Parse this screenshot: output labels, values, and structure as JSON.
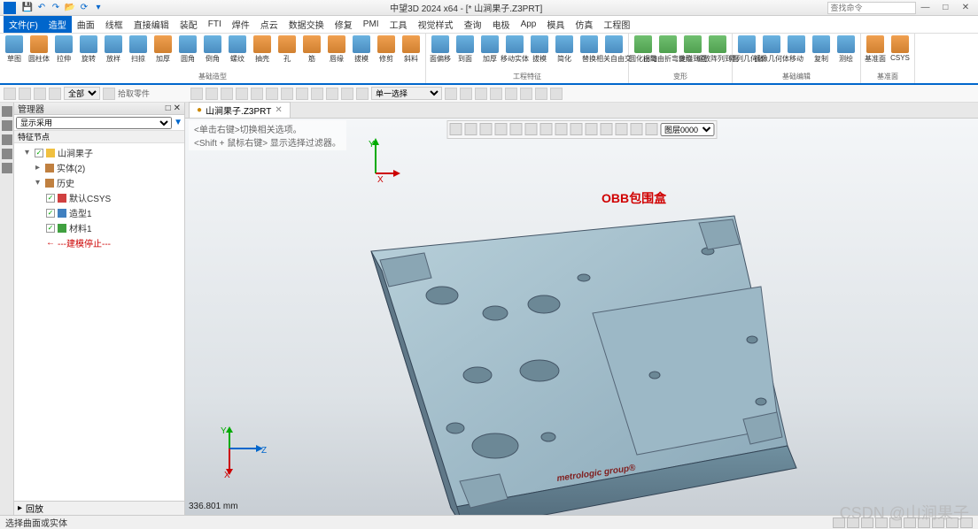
{
  "app": {
    "title": "中望3D 2024 x64 - [* 山涧果子.Z3PRT]",
    "search_placeholder": "查找命令"
  },
  "menu": {
    "file": "文件(F)",
    "items": [
      "造型",
      "曲面",
      "线框",
      "直接编辑",
      "装配",
      "FTI",
      "焊件",
      "点云",
      "数据交换",
      "修复",
      "PMI",
      "工具",
      "视觉样式",
      "查询",
      "电极",
      "App",
      "模具",
      "仿真",
      "工程图"
    ],
    "active_index": 0
  },
  "ribbon": {
    "groups": [
      {
        "label": "基础造型",
        "buttons": [
          "草图",
          "圆柱体",
          "拉伸",
          "旋转",
          "放样",
          "扫掠",
          "加厚",
          "圆角",
          "倒角",
          "螺纹",
          "抽壳",
          "孔",
          "筋",
          "唇缘",
          "拔模",
          "修剪",
          "斜料"
        ]
      },
      {
        "label": "工程特征",
        "buttons": [
          "面偏移",
          "到面",
          "加厚",
          "移动实体",
          "拔模",
          "简化",
          "替换",
          "相关自由交"
        ]
      },
      {
        "label": "变形",
        "buttons": [
          "圆化拐弯",
          "由随由折弯变形",
          "缠绕到面",
          "缩放阵列到面"
        ]
      },
      {
        "label": "基础编辑",
        "buttons": [
          "阵列几何体",
          "镜像几何体",
          "移动",
          "复制",
          "测绘"
        ]
      },
      {
        "label": "基准面",
        "buttons": [
          "基准面",
          "CSYS"
        ]
      }
    ]
  },
  "toolbar2": {
    "select_all": "全部",
    "middle_text": "拾取零件",
    "select_mode": "单一选择"
  },
  "panel": {
    "header": "管理器",
    "dropdown": "显示采用",
    "subheader": "特征节点",
    "tree": [
      {
        "level": 1,
        "exp": "▾",
        "check": true,
        "icon": "part",
        "label": "山涧果子",
        "red": false
      },
      {
        "level": 2,
        "exp": "▸",
        "check": false,
        "icon": "folder",
        "label": "实体(2)",
        "red": false
      },
      {
        "level": 2,
        "exp": "▾",
        "check": false,
        "icon": "folder",
        "label": "历史",
        "red": false
      },
      {
        "level": 3,
        "exp": "",
        "check": true,
        "icon": "csys",
        "label": "默认CSYS",
        "red": false
      },
      {
        "level": 3,
        "exp": "",
        "check": true,
        "icon": "shape",
        "label": "造型1",
        "red": false
      },
      {
        "level": 3,
        "exp": "",
        "check": true,
        "icon": "mat",
        "label": "材料1",
        "red": false
      },
      {
        "level": 3,
        "exp": "",
        "check": false,
        "icon": "arrow",
        "label": "---建模停止---",
        "red": true
      }
    ],
    "footer_label": "回放"
  },
  "tabs": {
    "active": "山涧果子.Z3PRT"
  },
  "hints": {
    "line1": "<单击右键>切换相关选项。",
    "line2": "<Shift + 鼠标右键> 显示选择过滤器。"
  },
  "viewport": {
    "annotation": "OBB包围盒",
    "model_brand": "metrologic group®",
    "dimension": "336.801 mm",
    "axes_origin": [
      "X",
      "Y"
    ],
    "axes_bottom": [
      "X",
      "Y",
      "Z"
    ],
    "layer_dropdown": "图层0000"
  },
  "statusbar": {
    "text": "选择曲面或实体"
  },
  "watermark": "CSDN @山涧果子"
}
